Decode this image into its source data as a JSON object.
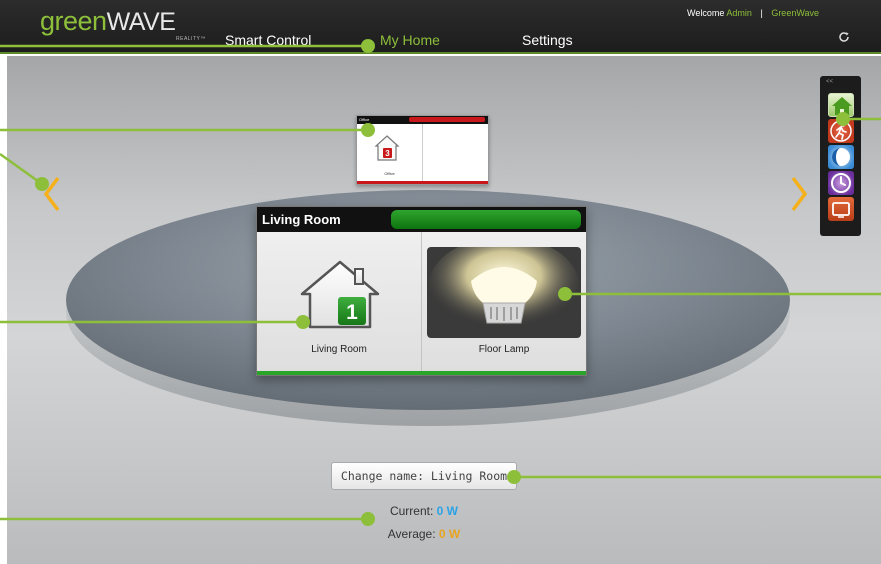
{
  "header": {
    "logo": {
      "green": "green",
      "wave": "WAVE",
      "sub": "REALITY™"
    },
    "nav": [
      {
        "label": "Smart Control",
        "active": false
      },
      {
        "label": "My Home",
        "active": true
      },
      {
        "label": "Settings",
        "active": false
      }
    ],
    "welcome": {
      "prefix": "Welcome",
      "user": "Admin",
      "separator": "|",
      "account": "GreenWave"
    },
    "refresh_icon": "refresh-icon"
  },
  "rooms": {
    "office": {
      "title": "Office",
      "label": "Office",
      "badge": "3",
      "status_color": "#c8181c"
    },
    "living": {
      "title": "Living Room",
      "room_label": "Living Room",
      "badge": "1",
      "device_label": "Floor Lamp",
      "status_color": "#2aa52a"
    }
  },
  "side_panel": {
    "collapse": "<<",
    "buttons": [
      "home-icon",
      "running-man-icon",
      "eco-icon",
      "clock-icon",
      "tv-icon"
    ]
  },
  "controls": {
    "change_name": "Change name: Living Room",
    "current_label": "Current:",
    "current_value": "0 W",
    "average_label": "Average:",
    "average_value": "0 W"
  },
  "colors": {
    "brand_green": "#8dbf3a",
    "accent_orange": "#f5b01a",
    "current_blue": "#2aa3e8",
    "average_orange": "#e8a41e"
  }
}
